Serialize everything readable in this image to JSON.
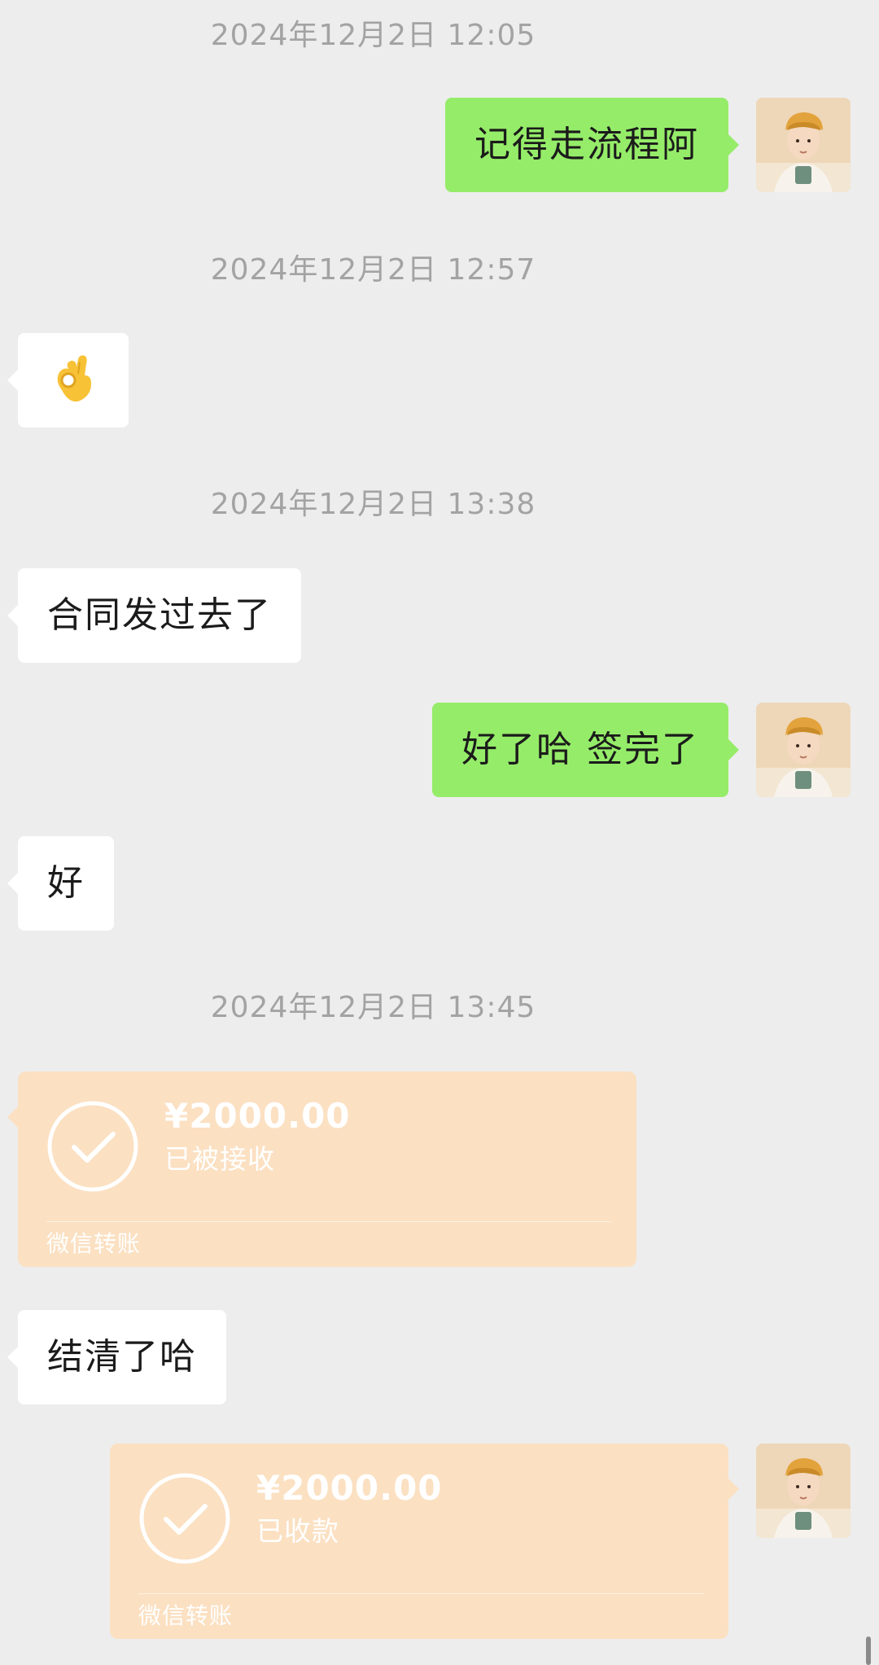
{
  "timestamps": [
    "2024年12月2日 12:05",
    "2024年12月2日 12:57",
    "2024年12月2日 13:38",
    "2024年12月2日 13:45"
  ],
  "messages": {
    "m1": "记得走流程阿",
    "m2_icon": "ok-hand-icon",
    "m3": "合同发过去了",
    "m4": "好了哈 签完了",
    "m5": "好",
    "m6": "结清了哈"
  },
  "transfers": [
    {
      "amount": "¥2000.00",
      "status": "已被接收",
      "footer": "微信转账"
    },
    {
      "amount": "¥2000.00",
      "status": "已收款",
      "footer": "微信转账"
    }
  ],
  "colors": {
    "background": "#ededed",
    "outgoing_bubble": "#95ec69",
    "incoming_bubble": "#ffffff",
    "transfer_card": "#fbe0c2",
    "timestamp_text": "#a3a3a3"
  }
}
